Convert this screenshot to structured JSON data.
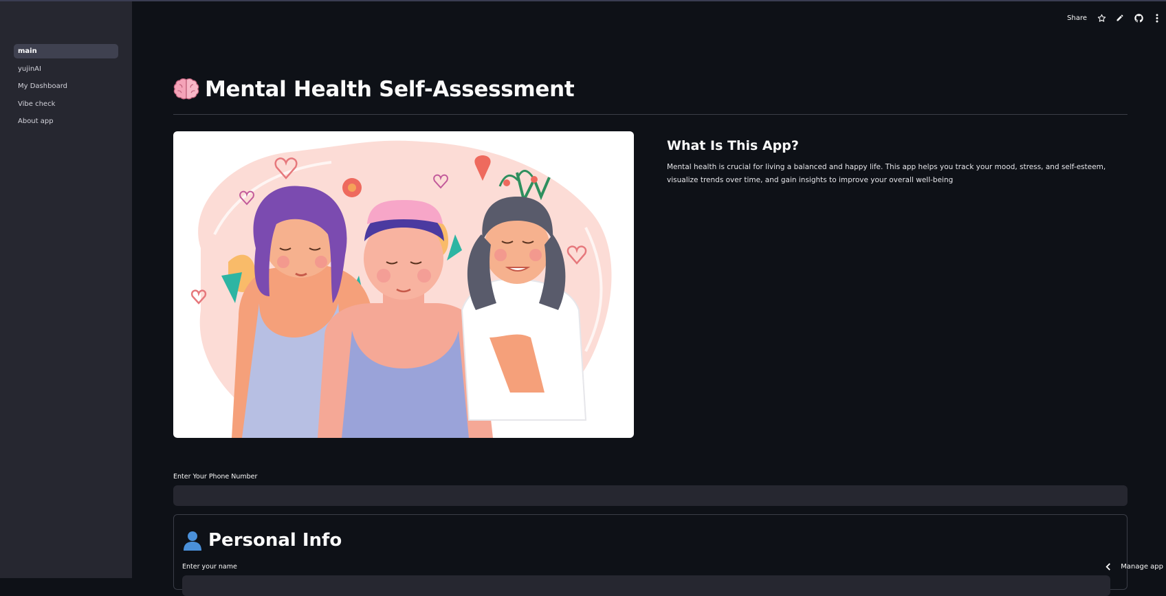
{
  "sidebar": {
    "items": [
      {
        "label": "main",
        "active": true
      },
      {
        "label": "yujinAI",
        "active": false
      },
      {
        "label": "My Dashboard",
        "active": false
      },
      {
        "label": "Vibe check",
        "active": false
      },
      {
        "label": "About app",
        "active": false
      }
    ]
  },
  "toolbar": {
    "share_label": "Share",
    "icons": [
      "star-icon",
      "pencil-icon",
      "github-icon",
      "more-vertical-icon"
    ]
  },
  "main": {
    "title": "Mental Health Self-Assessment",
    "title_icon": "brain-icon",
    "about": {
      "heading": "What Is This App?",
      "body": "Mental health is crucial for living a balanced and happy life. This app helps you track your mood, stress, and self-esteem, visualize trends over time, and gain insights to improve your overall well-being"
    },
    "phone": {
      "label": "Enter Your Phone Number",
      "value": "",
      "placeholder": ""
    },
    "personal_info": {
      "heading": "Personal Info",
      "icon": "person-icon",
      "name_label": "Enter your name"
    }
  },
  "footer": {
    "manage_label": "Manage app"
  },
  "colors": {
    "background": "#0e1117",
    "sidebar": "#262730",
    "input": "#262730",
    "text": "#fafafa"
  }
}
